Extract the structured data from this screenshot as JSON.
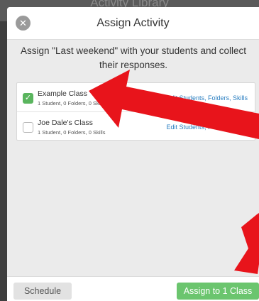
{
  "background": {
    "title": "Activity Library"
  },
  "modal": {
    "title": "Assign Activity",
    "instructions": "Assign \"Last weekend\" with your students and collect their responses."
  },
  "classes": [
    {
      "name": "Example Class",
      "meta": "1 Student, 0 Folders, 0 Skills",
      "checked": true,
      "edit_label": "Edit Students, Folders, Skills"
    },
    {
      "name": "Joe Dale's Class",
      "meta": "1 Student, 0 Folders, 0 Skills",
      "checked": false,
      "edit_label": "Edit Students, Folders, Skills"
    }
  ],
  "footer": {
    "schedule_label": "Schedule",
    "assign_label": "Assign to 1 Class"
  },
  "icons": {
    "close": "close-icon",
    "check": "check-icon"
  },
  "colors": {
    "accent_green": "#5ab55e",
    "assign_green": "#6bc56e",
    "link_blue": "#2b7fc1",
    "annotation_red": "#e8141b"
  }
}
